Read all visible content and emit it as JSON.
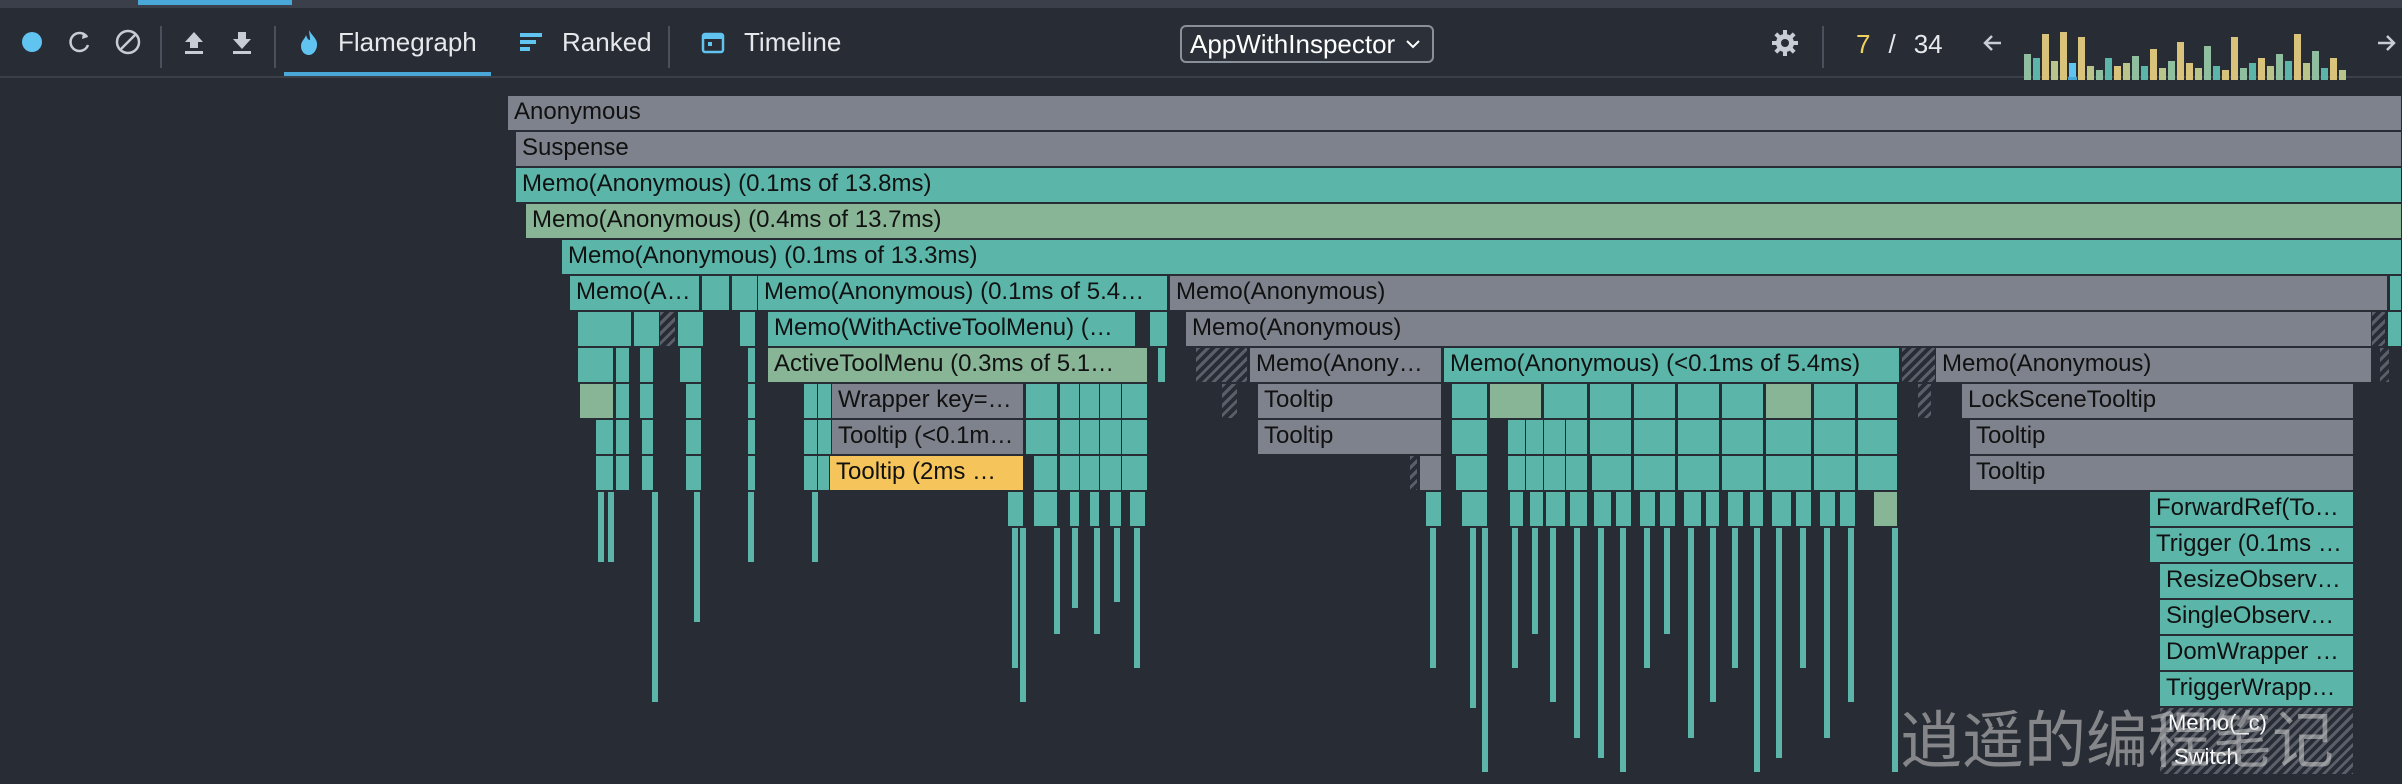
{
  "toolbar": {
    "tabs": [
      {
        "label": "Flamegraph",
        "icon": "flame-icon",
        "active": true
      },
      {
        "label": "Ranked",
        "icon": "ranked-bars-icon",
        "active": false
      },
      {
        "label": "Timeline",
        "icon": "calendar-icon",
        "active": false
      }
    ],
    "root_selector": "AppWithInspector",
    "commit": {
      "current": "7",
      "total": "34"
    },
    "commit_bar_heights": [
      0.55,
      0.45,
      0.95,
      0.4,
      1.0,
      0.35,
      0.9,
      0.3,
      0.2,
      0.45,
      0.3,
      0.35,
      0.5,
      0.3,
      0.65,
      0.25,
      0.4,
      0.8,
      0.35,
      0.25,
      0.7,
      0.3,
      0.2,
      0.9,
      0.25,
      0.35,
      0.45,
      0.3,
      0.55,
      0.4,
      0.95,
      0.35,
      0.6,
      0.25,
      0.45,
      0.2
    ],
    "commit_selected_index": 5,
    "colors": {
      "accent": "#4aa8d8",
      "record": "#61c3f0",
      "selected_commit": "#f0d060"
    }
  },
  "flamegraph": {
    "nodes": {
      "anonymous_root": "Anonymous",
      "suspense": "Suspense",
      "memo_a": "Memo(Anonymous) (0.1ms of 13.8ms)",
      "memo_b": "Memo(Anonymous) (0.4ms of 13.7ms)",
      "memo_c": "Memo(Anonymous) (0.1ms of 13.3ms)",
      "memo_d": "Memo(A…",
      "memo_e": "Memo(Anonymous) (0.1ms of 5.4…",
      "memo_f": "Memo(Anonymous)",
      "memo_with_tool": "Memo(WithActiveToolMenu) (…",
      "memo_g": "Memo(Anonymous)",
      "active_tool_menu": "ActiveToolMenu (0.3ms of 5.1…",
      "memo_h": "Memo(Anony…",
      "memo_i": "Memo(Anonymous) (<0.1ms of 5.4ms)",
      "memo_j": "Memo(Anonymous)",
      "wrapper_key": "Wrapper key=…",
      "tooltip_1": "Tooltip",
      "lock_scene_tooltip": "LockSceneTooltip",
      "tooltip_2": "Tooltip (<0.1m…",
      "tooltip_3": "Tooltip",
      "tooltip_4": "Tooltip",
      "tooltip_selected": "Tooltip (2ms …",
      "tooltip_5": "Tooltip",
      "forward_ref": "ForwardRef(To…",
      "trigger": "Trigger (0.1ms …",
      "resize_observer": "ResizeObserv…",
      "single_observer": "SingleObserv…",
      "dom_wrapper": "DomWrapper …",
      "trigger_wrapper": "TriggerWrapp…",
      "memo_c_small": "Memo(_c)",
      "switch": "Switch"
    },
    "colors": {
      "gray": "#7e828c",
      "teal": "#5bb5a9",
      "green": "#88b596",
      "selected": "#f5c45a"
    }
  },
  "watermark": "逍遥的编程笔记"
}
